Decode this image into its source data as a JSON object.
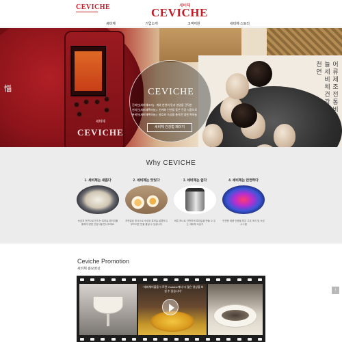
{
  "header": {
    "small_logo": "CEVICHE",
    "main_logo": "CEVICHE",
    "main_logo_korean": "세비체",
    "nav": [
      "세비체",
      "기업소개",
      "고객지원",
      "세비체 스토리"
    ]
  },
  "hero": {
    "side_char": "惱",
    "cooker_brand": "CEVICHE",
    "cooker_brand_korean": "세비체",
    "title": "CEVICHE",
    "text": [
      "진비천(세비체조리) : 계와 천연의 맛과 영양을 간직한",
      "천지인(세비체흑마늘) : 천계와 인연을 품은 건강 식품으로",
      "완비천(세비체흑마늘) : 발효와 숙성을 통해 탄생한 흑마늘"
    ],
    "button_label": "세비체 건강법 페이지",
    "paper_glyphs": "어류제조전통비법흑마늘세비체건강숙성발효천연"
  },
  "why": {
    "title": "Why CEVICHE",
    "features": [
      {
        "title": "1. 세비체는 새롭다",
        "desc": "숙성과 천연으로 만드는 흑마늘 페이지를 통해 다양한 건강식을 만나보세요"
      },
      {
        "title": "2. 세비체는 맛있다",
        "desc": "자연발효 방식으로 숙성된 흑마늘 달콤하고 부드러운 맛을 즐길 수 있습니다"
      },
      {
        "title": "3. 세비체는 쉽다",
        "desc": "버튼 하나로 간편하게 흑마늘을 만들 수 있는 세비체 숙성기"
      },
      {
        "title": "4. 세비체는 안전하다",
        "desc": "안전한 제품 인증을 받은 고온 조리 및 숙성 시스템"
      }
    ]
  },
  "promotion": {
    "title": "Ceviche Promotion",
    "subtitle": "세비체 홍보영상",
    "caption": "\"세비체어플을 누르면 Youtube에서 더 많은 영상을 보실 수 있습니다\""
  },
  "scroll_top_label": "↑",
  "colors": {
    "brand": "#c51b25",
    "section_bg": "#ececec",
    "film": "#1d1d1d"
  }
}
